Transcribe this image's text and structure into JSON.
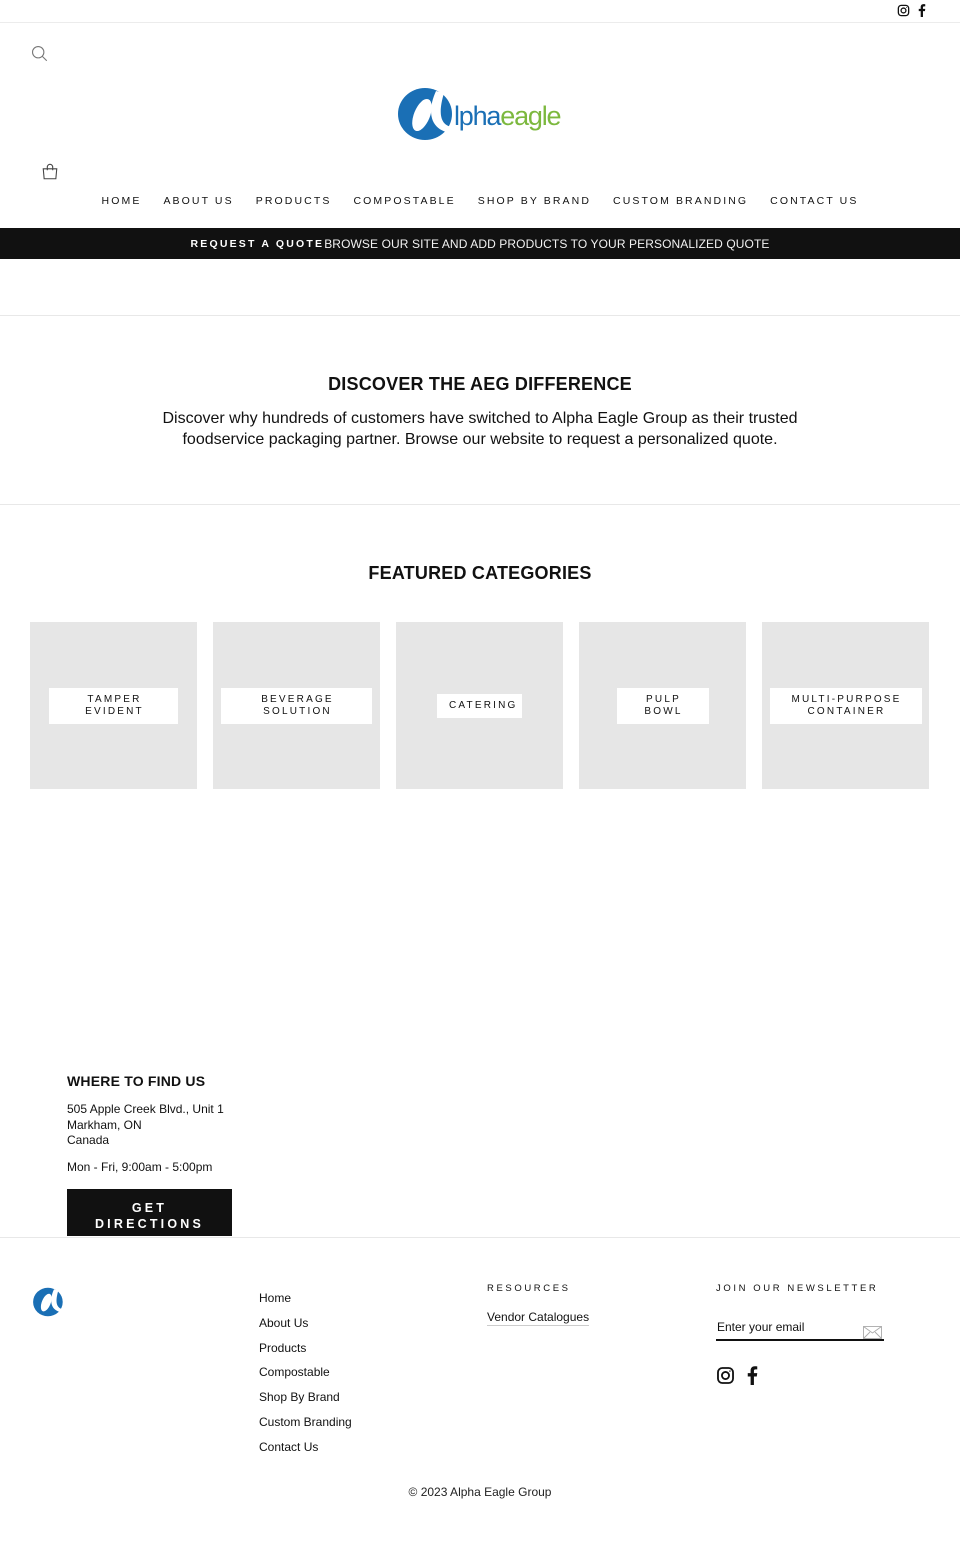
{
  "utility": {
    "social": [
      {
        "name": "instagram",
        "icon": "instagram-icon"
      },
      {
        "name": "facebook",
        "icon": "facebook-icon"
      }
    ]
  },
  "header": {
    "search_icon": "search-icon",
    "cart_icon": "shopping-bag-icon",
    "logo": {
      "alpha_glyph": "α",
      "word_pha": "lpha",
      "word_eagle": "eagle",
      "alt": "Alpha Eagle",
      "colors": {
        "blue": "#1a6fb5",
        "green": "#7cb83e"
      }
    },
    "nav": [
      {
        "label": "HOME"
      },
      {
        "label": "ABOUT US"
      },
      {
        "label": "PRODUCTS"
      },
      {
        "label": "COMPOSTABLE"
      },
      {
        "label": "SHOP BY BRAND"
      },
      {
        "label": "CUSTOM BRANDING"
      },
      {
        "label": "CONTACT US"
      }
    ]
  },
  "announcement": {
    "strong": "REQUEST A QUOTE",
    "message": "BROWSE OUR SITE AND ADD PRODUCTS TO YOUR PERSONALIZED QUOTE"
  },
  "intro": {
    "title": "DISCOVER THE AEG DIFFERENCE",
    "body": "Discover why hundreds of customers have switched to Alpha Eagle Group as their trusted foodservice packaging partner. Browse our website to request a personalized quote."
  },
  "featured": {
    "title": "FEATURED CATEGORIES",
    "categories": [
      {
        "label": "TAMPER\nEVIDENT"
      },
      {
        "label": "BEVERAGE\nSOLUTION"
      },
      {
        "label": "CATERING"
      },
      {
        "label": "PULP\nBOWL"
      },
      {
        "label": "MULTI-PURPOSE\nCONTAINER"
      }
    ]
  },
  "find_us": {
    "title": "WHERE TO FIND US",
    "address_line1": "505 Apple Creek Blvd., Unit 1",
    "address_line2": "Markham, ON",
    "address_line3": "Canada",
    "hours": "Mon - Fri, 9:00am - 5:00pm",
    "button": "GET\nDIRECTIONS"
  },
  "footer": {
    "links": [
      {
        "label": "Home"
      },
      {
        "label": "About Us"
      },
      {
        "label": "Products"
      },
      {
        "label": "Compostable"
      },
      {
        "label": "Shop By Brand"
      },
      {
        "label": "Custom Branding"
      },
      {
        "label": "Contact Us"
      }
    ],
    "resources_heading": "RESOURCES",
    "resources_link": "Vendor Catalogues",
    "newsletter_heading": "JOIN OUR NEWSLETTER",
    "email_placeholder": "Enter your email",
    "email_value": "",
    "submit_icon": "envelope-icon",
    "copyright": "© 2023 Alpha Eagle Group"
  }
}
